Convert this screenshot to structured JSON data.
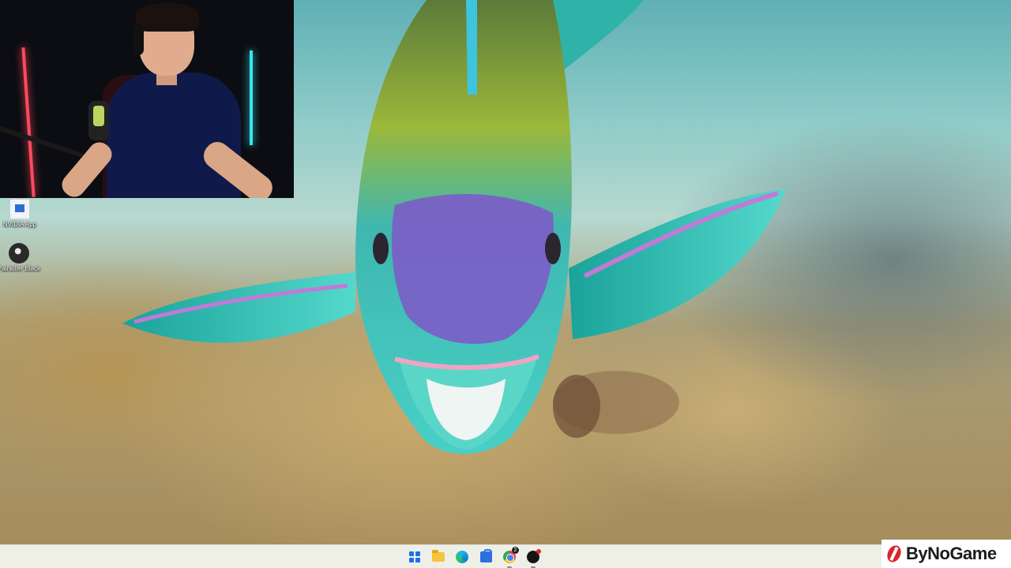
{
  "desktop": {
    "icons": [
      {
        "label": "NVIDIA App",
        "icon": "nvidia-app-icon"
      },
      {
        "label": "Painkiller Black",
        "icon": "painkiller-black-icon"
      }
    ]
  },
  "taskbar": {
    "items": [
      {
        "name": "start",
        "icon": "windows-start-icon"
      },
      {
        "name": "file-explorer",
        "icon": "folder-icon"
      },
      {
        "name": "edge",
        "icon": "edge-browser-icon"
      },
      {
        "name": "store",
        "icon": "microsoft-store-icon"
      },
      {
        "name": "chrome",
        "icon": "chrome-icon",
        "badge": "2"
      },
      {
        "name": "app",
        "icon": "app-icon"
      }
    ]
  },
  "watermark": {
    "text": "ByNoGame"
  },
  "colors": {
    "taskbar_bg": "#eef0e8",
    "watermark_red": "#d8262d"
  }
}
